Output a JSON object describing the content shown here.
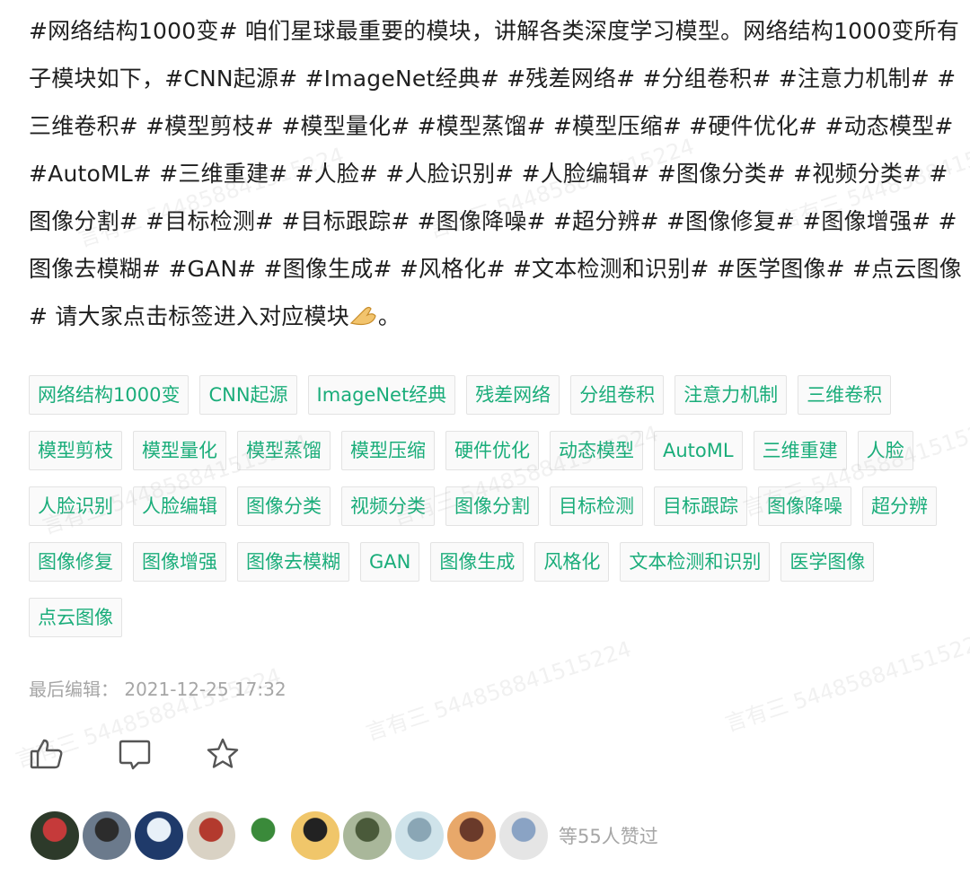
{
  "post": {
    "segments": [
      {
        "t": "#网络结构1000变#",
        "tag": true
      },
      {
        "t": " 咱们星球最重要的模块，讲解各类深度学习模型。网络结构1000变所有子模块如下，"
      },
      {
        "t": "#CNN起源#",
        "tag": true
      },
      {
        "t": " "
      },
      {
        "t": "#ImageNet经典#",
        "tag": true
      },
      {
        "t": " "
      },
      {
        "t": "#残差网络#",
        "tag": true
      },
      {
        "t": " "
      },
      {
        "t": "#分组卷积#",
        "tag": true
      },
      {
        "t": " "
      },
      {
        "t": "#注意力机制#",
        "tag": true
      },
      {
        "t": " "
      },
      {
        "t": "#三维卷积#",
        "tag": true
      },
      {
        "t": " "
      },
      {
        "t": "#模型剪枝#",
        "tag": true
      },
      {
        "t": " "
      },
      {
        "t": "#模型量化#",
        "tag": true
      },
      {
        "t": " "
      },
      {
        "t": "#模型蒸馏#",
        "tag": true
      },
      {
        "t": " "
      },
      {
        "t": "#模型压缩#",
        "tag": true
      },
      {
        "t": " "
      },
      {
        "t": "#硬件优化#",
        "tag": true
      },
      {
        "t": " "
      },
      {
        "t": "#动态模型#",
        "tag": true
      },
      {
        "t": "  "
      },
      {
        "t": "#AutoML#",
        "tag": true
      },
      {
        "t": " "
      },
      {
        "t": "#三维重建#",
        "tag": true
      },
      {
        "t": " "
      },
      {
        "t": "#人脸#",
        "tag": true
      },
      {
        "t": " "
      },
      {
        "t": "#人脸识别#",
        "tag": true
      },
      {
        "t": " "
      },
      {
        "t": "#人脸编辑#",
        "tag": true
      },
      {
        "t": " "
      },
      {
        "t": "#图像分类#",
        "tag": true
      },
      {
        "t": " "
      },
      {
        "t": "#视频分类#",
        "tag": true
      },
      {
        "t": " "
      },
      {
        "t": "#图像分割#",
        "tag": true
      },
      {
        "t": " "
      },
      {
        "t": "#目标检测#",
        "tag": true
      },
      {
        "t": " "
      },
      {
        "t": "#目标跟踪#",
        "tag": true
      },
      {
        "t": " "
      },
      {
        "t": "#图像降噪#",
        "tag": true
      },
      {
        "t": " "
      },
      {
        "t": "#超分辨#",
        "tag": true
      },
      {
        "t": " "
      },
      {
        "t": "#图像修复#",
        "tag": true
      },
      {
        "t": " "
      },
      {
        "t": "#图像增强#",
        "tag": true
      },
      {
        "t": " "
      },
      {
        "t": "#图像去模糊#",
        "tag": true
      },
      {
        "t": " "
      },
      {
        "t": "#GAN#",
        "tag": true
      },
      {
        "t": " "
      },
      {
        "t": "#图像生成#",
        "tag": true
      },
      {
        "t": " "
      },
      {
        "t": "#风格化#",
        "tag": true
      },
      {
        "t": " "
      },
      {
        "t": "#文本检测和识别#",
        "tag": true
      },
      {
        "t": " "
      },
      {
        "t": "#医学图像#",
        "tag": true
      },
      {
        "t": " "
      },
      {
        "t": "#点云图像#",
        "tag": true
      },
      {
        "t": "  请大家点击标签进入对应模块"
      },
      {
        "emoji": "pinched-hand-icon"
      },
      {
        "t": "。"
      }
    ]
  },
  "tags": [
    "网络结构1000变",
    "CNN起源",
    "ImageNet经典",
    "残差网络",
    "分组卷积",
    "注意力机制",
    "三维卷积",
    "模型剪枝",
    "模型量化",
    "模型蒸馏",
    "模型压缩",
    "硬件优化",
    "动态模型",
    "AutoML",
    "三维重建",
    "人脸",
    "人脸识别",
    "人脸编辑",
    "图像分类",
    "视频分类",
    "图像分割",
    "目标检测",
    "目标跟踪",
    "图像降噪",
    "超分辨",
    "图像修复",
    "图像增强",
    "图像去模糊",
    "GAN",
    "图像生成",
    "风格化",
    "文本检测和识别",
    "医学图像",
    "点云图像"
  ],
  "edited": {
    "label": "最后编辑：",
    "time": "2021-12-25 17:32"
  },
  "actions": {
    "like_icon": "thumbs-up-icon",
    "comment_icon": "comment-icon",
    "star_icon": "star-icon"
  },
  "likers": {
    "count_text": "等55人赞过",
    "avatars": [
      {
        "colors": [
          "#2d3a2a",
          "#c53a3a"
        ]
      },
      {
        "colors": [
          "#6b7a8c",
          "#2c2c2c"
        ]
      },
      {
        "colors": [
          "#1f3a6a",
          "#e8f0f8"
        ]
      },
      {
        "colors": [
          "#d9d2c4",
          "#b33a2e"
        ]
      },
      {
        "colors": [
          "#ffffff",
          "#3a8a3a"
        ]
      },
      {
        "colors": [
          "#f0c66a",
          "#222222"
        ]
      },
      {
        "colors": [
          "#a9b79a",
          "#4a5a3a"
        ]
      },
      {
        "colors": [
          "#cfe3ea",
          "#8aa6b5"
        ]
      },
      {
        "colors": [
          "#e8a86a",
          "#6a3a2a"
        ]
      },
      {
        "colors": [
          "#e5e5e5",
          "#8aa3c4"
        ]
      }
    ]
  },
  "watermark": "言有三 544858841515224",
  "colors": {
    "tag_text": "#1aad7a",
    "tag_border": "#e3e3e3",
    "muted": "#a6a6a6"
  }
}
